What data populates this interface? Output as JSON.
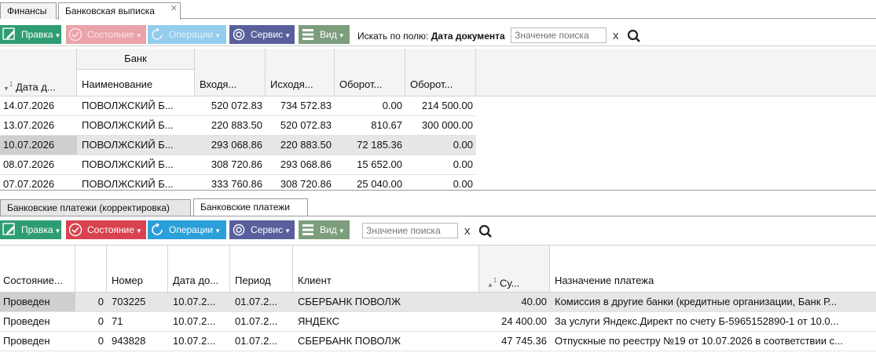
{
  "top_tabs": [
    {
      "label": "Финансы"
    },
    {
      "label": "Банковская выписка"
    }
  ],
  "toolbar1": {
    "edit": "Правка",
    "state": "Состояние",
    "ops": "Операции",
    "service": "Сервис",
    "view": "Вид",
    "search_label": "Искать по полю:",
    "search_field": "Дата документа",
    "search_placeholder": "Значение поиска",
    "clear": "x"
  },
  "grid1": {
    "group_header": "Банк",
    "columns": [
      "Дата д...",
      "Наименование",
      "Входя...",
      "Исходя...",
      "Оборот...",
      "Оборот..."
    ],
    "sort_index": "1",
    "rows": [
      [
        "14.07.2026",
        "ПОВОЛЖСКИЙ Б...",
        "520 072.83",
        "734 572.83",
        "0.00",
        "214 500.00"
      ],
      [
        "13.07.2026",
        "ПОВОЛЖСКИЙ Б...",
        "220 883.50",
        "520 072.83",
        "810.67",
        "300 000.00"
      ],
      [
        "10.07.2026",
        "ПОВОЛЖСКИЙ Б...",
        "293 068.86",
        "220 883.50",
        "72 185.36",
        "0.00"
      ],
      [
        "08.07.2026",
        "ПОВОЛЖСКИЙ Б...",
        "308 720.86",
        "293 068.86",
        "15 652.00",
        "0.00"
      ],
      [
        "07.07.2026",
        "ПОВОЛЖСКИЙ Б...",
        "333 760.86",
        "308 720.86",
        "25 040.00",
        "0.00"
      ]
    ]
  },
  "bottom_tabs": [
    {
      "label": "Банковские платежи (корректировка)"
    },
    {
      "label": "Банковские платежи"
    }
  ],
  "toolbar2": {
    "edit": "Правка",
    "state": "Состояние",
    "ops": "Операции",
    "service": "Сервис",
    "view": "Вид",
    "search_placeholder": "Значение поиска",
    "clear": "x"
  },
  "grid2": {
    "columns": [
      "Состояние...",
      "",
      "Номер",
      "Дата до...",
      "Период",
      "Клиент",
      "Су...",
      "Назначение платежа"
    ],
    "sort_index": "1",
    "rows": [
      [
        "Проведен",
        "0",
        "703225",
        "10.07.2...",
        "01.07.2...",
        "СБЕРБАНК ПОВОЛЖ",
        "40.00",
        "Комиссия в другие банки (кредитные организации, Банк Р..."
      ],
      [
        "Проведен",
        "0",
        "71",
        "10.07.2...",
        "01.07.2...",
        "ЯНДЕКС",
        "24 400.00",
        "За услуги Яндекс.Директ по счету Б-5965152890-1 от 10.0..."
      ],
      [
        "Проведен",
        "0",
        "943828",
        "10.07.2...",
        "01.07.2...",
        "СБЕРБАНК ПОВОЛЖ",
        "47 745.36",
        "Отпускные по реестру №19 от 10.07.2026 в соответствии с..."
      ]
    ]
  },
  "colors": {
    "green": "#2f9d73",
    "red": "#d9434f",
    "blue": "#2b9fd9",
    "violet": "#5a5f9c",
    "gray": "#7d9e7d"
  }
}
